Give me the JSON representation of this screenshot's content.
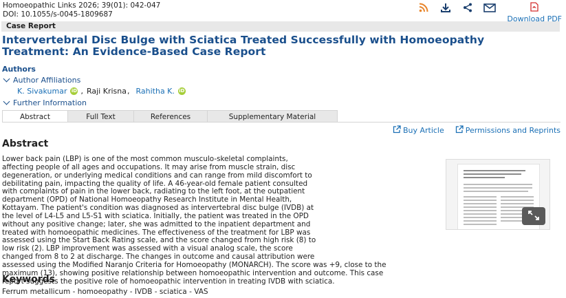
{
  "meta": {
    "citation": "Homoeopathic Links 2026; 39(01): 042-047",
    "doi": "DOI: 10.1055/s-0045-1809687"
  },
  "toolbar": {
    "icons": [
      "rss-icon",
      "download-icon",
      "share-icon",
      "email-icon",
      "pdf-icon"
    ],
    "download_pdf_label": "Download PDF",
    "accent_color": "#e8852b",
    "pdf_color": "#d32f2f"
  },
  "article": {
    "type_label": "Case Report",
    "title": "Intervertebral Disc Bulge with Sciatica Treated Successfully with Homoeopathy Treatment: An Evidence-Based Case Report"
  },
  "authors": {
    "heading": "Authors",
    "affiliations_toggle": "Author Affiliations",
    "list": [
      {
        "name": "K. Sivakumar",
        "orcid": true
      },
      {
        "name": "Raji Krisna",
        "orcid": false
      },
      {
        "name": "Rahitha K.",
        "orcid": true
      }
    ],
    "separator": ",",
    "further_info_toggle": "Further Information"
  },
  "tabs": [
    {
      "label": "Abstract",
      "active": true
    },
    {
      "label": "Full Text",
      "active": false
    },
    {
      "label": "References",
      "active": false
    },
    {
      "label": "Supplementary Material",
      "active": false
    }
  ],
  "actions": {
    "buy_article": "Buy Article",
    "permissions": "Permissions and Reprints"
  },
  "abstract": {
    "heading": "Abstract",
    "lines": [
      "Lower back pain (LBP) is one of the most common musculo-skeletal complaints,",
      "affecting people of all ages and occupations. It may arise from muscle strain, disc",
      "degeneration, or underlying medical conditions and can range from mild discomfort to",
      "debilitating pain, impacting the quality of life. A 46-year-old female patient consulted",
      "with complaints of pain in the lower back, radiating to the left foot, at the outpatient",
      "department (OPD) of National Homoeopathy Research Institute in Mental Health,",
      "Kottayam. The patient's condition was diagnosed as intervertebral disc bulge (IVDB) at",
      "the level of L4-L5 and L5-S1 with sciatica. Initially, the patient was treated in the OPD",
      "without any positive change; later, she was admitted to the inpatient department and",
      "treated with homoeopathic medicines. The effectiveness of the treatment for LBP was",
      "assessed using the Start Back Rating scale, and the score changed from high risk (8) to",
      "low risk (2). LBP improvement was assessed with a visual analog scale, the score",
      "changed from 8 to 2 at discharge. The changes in outcome and causal attribution were",
      "assessed using the Modified Naranjo Criteria for Homoeopathy (MONARCH). The score was +9, close to the",
      "maximum (13), showing positive relationship between homoeopathic intervention and outcome. This case",
      "report suggests the positive role of homoeopathic intervention in treating IVDB with sciatica."
    ]
  },
  "keywords": {
    "heading": "Keywords",
    "text": "Ferrum metallicum - homoeopathy - IVDB - sciatica - VAS"
  }
}
